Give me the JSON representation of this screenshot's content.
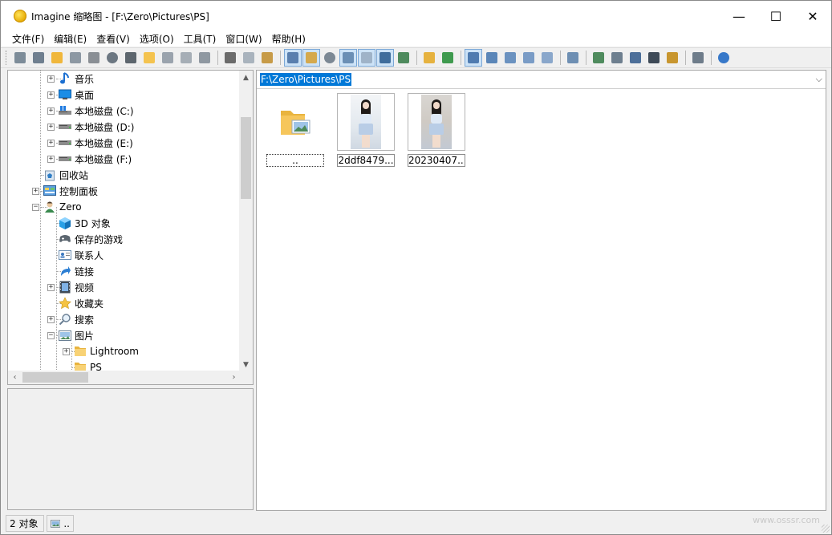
{
  "window": {
    "title": "Imagine 缩略图 - [F:\\Zero\\Pictures\\PS]",
    "minimize": "—",
    "maximize": "☐",
    "close": "✕"
  },
  "menu": [
    "文件(F)",
    "编辑(E)",
    "查看(V)",
    "选项(O)",
    "工具(T)",
    "窗口(W)",
    "帮助(H)"
  ],
  "toolbar": {
    "groups": [
      [
        "view-icon",
        "slideshow-icon",
        "open-folder-icon",
        "save-icon",
        "print-icon",
        "info-icon",
        "camera-icon",
        "new-folder-icon",
        "rename-icon",
        "trash-icon",
        "properties-icon"
      ],
      [
        "cut-icon",
        "copy-icon",
        "paste-icon"
      ],
      [
        "filmstrip-icon",
        "sort-icon",
        "clock-icon",
        "tiles-icon",
        "grid-icon",
        "fit-icon",
        "image-icon"
      ],
      [
        "up-folder-icon",
        "refresh-icon"
      ],
      [
        "thumbs-large-icon",
        "thumbs-medium-icon",
        "thumbs-small-icon",
        "list-icon",
        "details-icon"
      ],
      [
        "settings-icon"
      ],
      [
        "convert-icon",
        "batch-icon",
        "capture-icon",
        "film-icon",
        "edit-icon"
      ],
      [
        "notes-icon"
      ],
      [
        "help-icon"
      ]
    ],
    "pressed": [
      "filmstrip-icon",
      "sort-icon",
      "tiles-icon",
      "grid-icon",
      "fit-icon",
      "thumbs-large-icon"
    ]
  },
  "tree": {
    "items": [
      {
        "label": "音乐",
        "icon": "music-icon",
        "level": 2,
        "expander": "+"
      },
      {
        "label": "桌面",
        "icon": "desktop-icon",
        "level": 2,
        "expander": "+"
      },
      {
        "label": "本地磁盘 (C:)",
        "icon": "drive-c-icon",
        "level": 2,
        "expander": "+"
      },
      {
        "label": "本地磁盘 (D:)",
        "icon": "drive-icon",
        "level": 2,
        "expander": "+"
      },
      {
        "label": "本地磁盘 (E:)",
        "icon": "drive-icon",
        "level": 2,
        "expander": "+"
      },
      {
        "label": "本地磁盘 (F:)",
        "icon": "drive-icon",
        "level": 2,
        "expander": "+"
      },
      {
        "label": "回收站",
        "icon": "recycle-bin-icon",
        "level": 1,
        "expander": ""
      },
      {
        "label": "控制面板",
        "icon": "control-panel-icon",
        "level": 1,
        "expander": "+"
      },
      {
        "label": "Zero",
        "icon": "user-icon",
        "level": 1,
        "expander": "−"
      },
      {
        "label": "3D 对象",
        "icon": "cube-icon",
        "level": 2,
        "expander": ""
      },
      {
        "label": "保存的游戏",
        "icon": "games-icon",
        "level": 2,
        "expander": ""
      },
      {
        "label": "联系人",
        "icon": "contacts-icon",
        "level": 2,
        "expander": ""
      },
      {
        "label": "链接",
        "icon": "link-icon",
        "level": 2,
        "expander": ""
      },
      {
        "label": "视频",
        "icon": "video-icon",
        "level": 2,
        "expander": "+"
      },
      {
        "label": "收藏夹",
        "icon": "star-icon",
        "level": 2,
        "expander": ""
      },
      {
        "label": "搜索",
        "icon": "search-icon",
        "level": 2,
        "expander": "+"
      },
      {
        "label": "图片",
        "icon": "pictures-icon",
        "level": 2,
        "expander": "−"
      },
      {
        "label": "Lightroom",
        "icon": "folder-icon",
        "level": 3,
        "expander": "+"
      },
      {
        "label": "PS",
        "icon": "folder-icon",
        "level": 3,
        "expander": ""
      }
    ]
  },
  "address": {
    "path": "F:\\Zero\\Pictures\\PS"
  },
  "thumbnails": [
    {
      "label": "..",
      "kind": "parent-folder"
    },
    {
      "label": "2ddf8479...",
      "kind": "photo-light"
    },
    {
      "label": "20230407...",
      "kind": "photo-dark"
    }
  ],
  "status": {
    "count": "2 对象",
    "selected": ".."
  },
  "watermark": "www.osssr.com",
  "colors": {
    "selection": "#0078d7",
    "pressed": "#cde3f7",
    "folder": "#f6c65b"
  }
}
